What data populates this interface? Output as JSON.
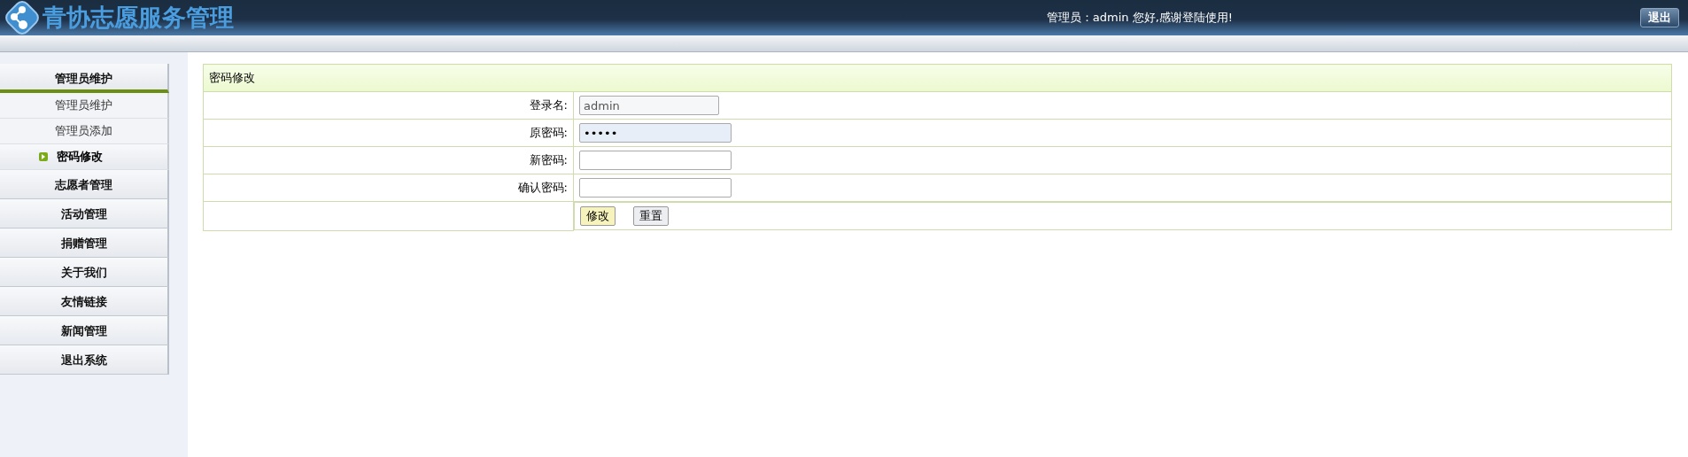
{
  "header": {
    "title": "青协志愿服务管理",
    "greeting": "管理员：admin 您好,感谢登陆使用!",
    "logout_button": "退出"
  },
  "sidebar": {
    "groups": [
      {
        "label": "管理员维护",
        "expanded": true,
        "items": [
          {
            "label": "管理员维护",
            "selected": false
          },
          {
            "label": "管理员添加",
            "selected": false
          },
          {
            "label": "密码修改",
            "selected": true
          }
        ]
      },
      {
        "label": "志愿者管理",
        "expanded": false
      },
      {
        "label": "活动管理",
        "expanded": false
      },
      {
        "label": "捐赠管理",
        "expanded": false
      },
      {
        "label": "关于我们",
        "expanded": false
      },
      {
        "label": "友情链接",
        "expanded": false
      },
      {
        "label": "新闻管理",
        "expanded": false
      },
      {
        "label": "退出系统",
        "expanded": false
      }
    ]
  },
  "form": {
    "title": "密码修改",
    "fields": [
      {
        "label": "登录名:",
        "value": "admin",
        "readonly": true,
        "autofilled": false
      },
      {
        "label": "原密码:",
        "value": "•••••",
        "readonly": false,
        "autofilled": true
      },
      {
        "label": "新密码:",
        "readonly": false,
        "autofilled": false
      },
      {
        "label": "确认密码:",
        "readonly": false,
        "autofilled": false
      }
    ],
    "buttons": [
      {
        "label": "修改",
        "kind": "primary"
      },
      {
        "label": "重置",
        "kind": "secondary"
      }
    ]
  }
}
